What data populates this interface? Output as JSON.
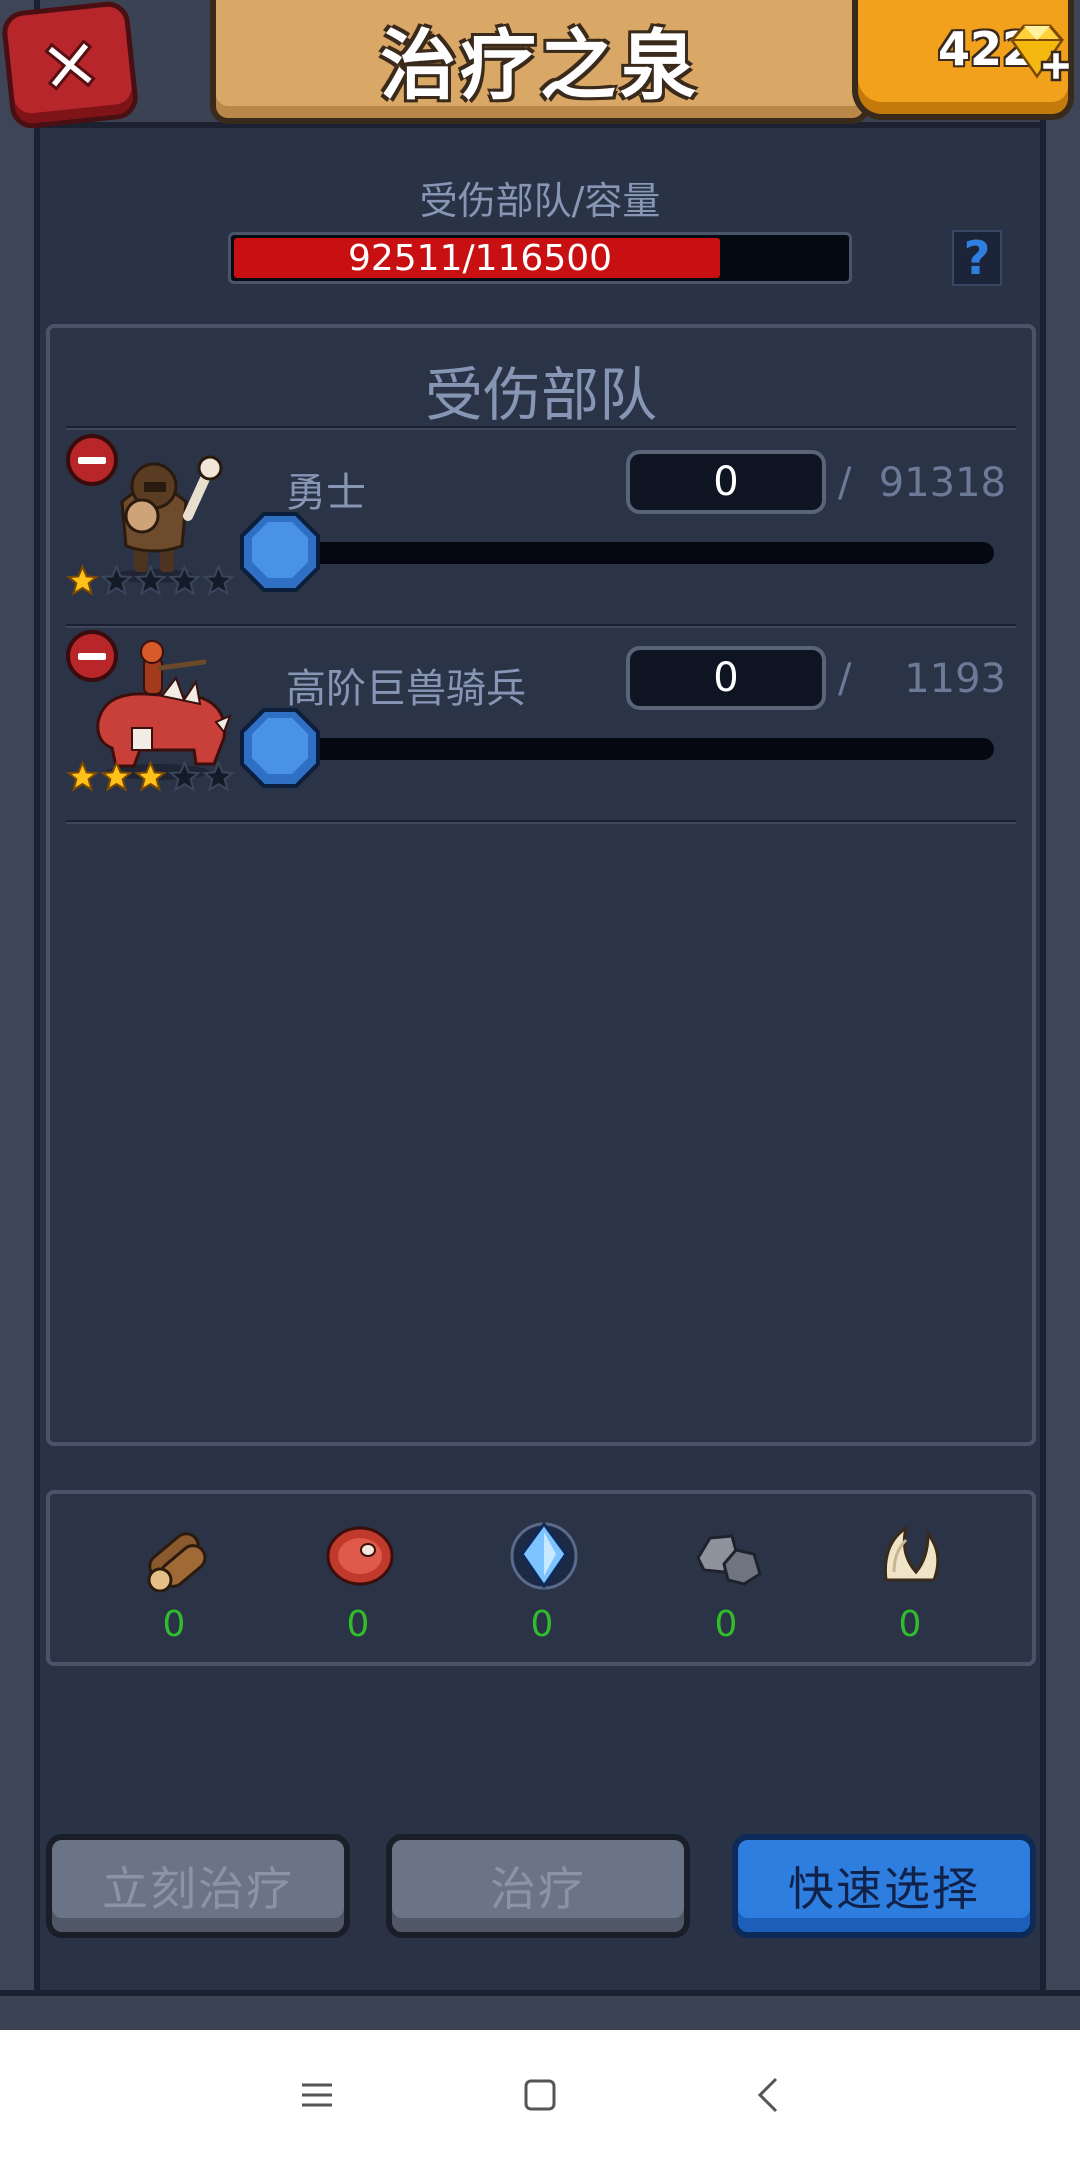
{
  "header": {
    "title": "治疗之泉",
    "gem_count": "422",
    "icons": {
      "close": "close-icon",
      "gem": "diamond-icon",
      "add": "plus-icon"
    }
  },
  "capacity": {
    "label": "受伤部队/容量",
    "value_text": "92511/116500",
    "current": 92511,
    "max": 116500,
    "help_label": "?"
  },
  "troops": {
    "title": "受伤部队",
    "separator": "/",
    "items": [
      {
        "name": "勇士",
        "input_value": "0",
        "max": "91318",
        "stars": 1,
        "stars_total": 5,
        "slider_fraction": 0
      },
      {
        "name": "高阶巨兽骑兵",
        "input_value": "0",
        "max": "1193",
        "stars": 3,
        "stars_total": 5,
        "slider_fraction": 0
      }
    ]
  },
  "resources": [
    {
      "icon": "wood-icon",
      "value": "0"
    },
    {
      "icon": "meat-icon",
      "value": "0"
    },
    {
      "icon": "crystal-icon",
      "value": "0"
    },
    {
      "icon": "stone-icon",
      "value": "0"
    },
    {
      "icon": "tusk-icon",
      "value": "0"
    }
  ],
  "buttons": {
    "heal_now": "立刻治疗",
    "heal": "治疗",
    "quick_select": "快速选择"
  },
  "colors": {
    "background": "#2a3245",
    "capacity_fill": "#c80f12",
    "resource_value": "#2fbd2c",
    "primary_button": "#2e7ee0"
  },
  "navbar": {
    "icons": [
      "menu-icon",
      "home-icon",
      "back-icon"
    ]
  }
}
